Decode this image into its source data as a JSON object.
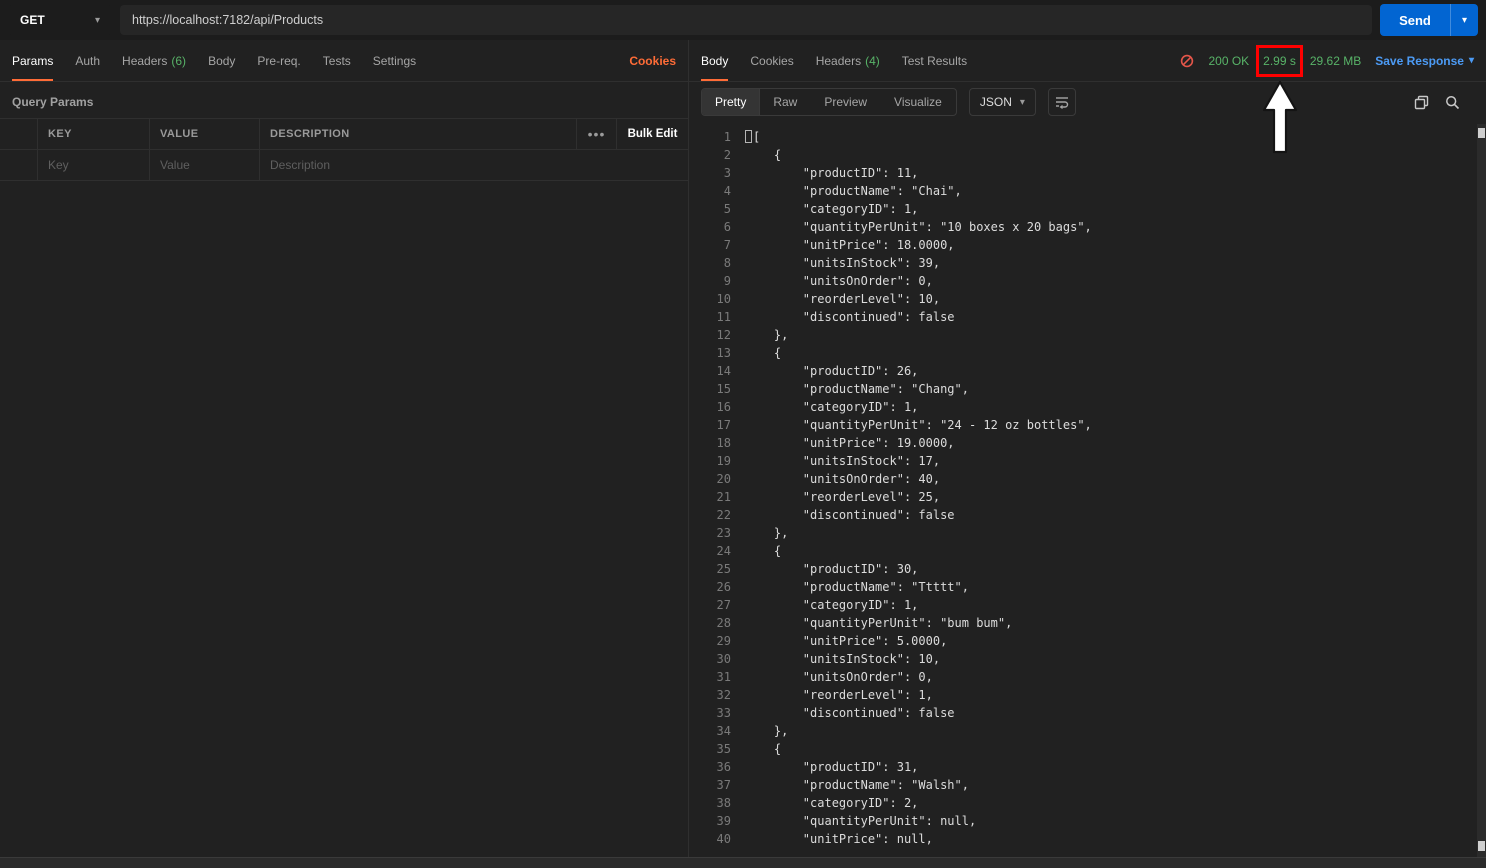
{
  "colors": {
    "accent_orange": "#ff6c37",
    "status_green": "#58b368",
    "link_blue": "#4c9bf5",
    "send_blue": "#0265d2",
    "annotation_red": "#ff0000"
  },
  "icons": {
    "chevron_down": "▾",
    "more": "•••"
  },
  "request_bar": {
    "method": "GET",
    "url": "https://localhost:7182/api/Products",
    "send_label": "Send"
  },
  "request_tabs": {
    "items": [
      {
        "label": "Params",
        "count": "",
        "active": true
      },
      {
        "label": "Auth",
        "count": "",
        "active": false
      },
      {
        "label": "Headers",
        "count": "(6)",
        "active": false
      },
      {
        "label": "Body",
        "count": "",
        "active": false
      },
      {
        "label": "Pre-req.",
        "count": "",
        "active": false
      },
      {
        "label": "Tests",
        "count": "",
        "active": false
      },
      {
        "label": "Settings",
        "count": "",
        "active": false
      }
    ],
    "cookies_link": "Cookies"
  },
  "query_params": {
    "title": "Query Params",
    "columns": [
      "KEY",
      "VALUE",
      "DESCRIPTION"
    ],
    "more_icon": "•••",
    "bulk_edit_label": "Bulk Edit",
    "row_placeholders": {
      "key": "Key",
      "value": "Value",
      "description": "Description"
    }
  },
  "response": {
    "tabs": [
      {
        "label": "Body",
        "count": "",
        "active": true
      },
      {
        "label": "Cookies",
        "count": "",
        "active": false
      },
      {
        "label": "Headers",
        "count": "(4)",
        "active": false
      },
      {
        "label": "Test Results",
        "count": "",
        "active": false
      }
    ],
    "meta": {
      "status": "200 OK",
      "time": "2.99 s",
      "size": "29.62 MB",
      "save_label": "Save Response"
    },
    "toolbar": {
      "views": [
        "Pretty",
        "Raw",
        "Preview",
        "Visualize"
      ],
      "active_view": "Pretty",
      "format": "JSON"
    }
  },
  "annotation": {
    "highlight_target": "response-time",
    "highlighted_value": "2.99 s"
  },
  "response_body": {
    "language": "json",
    "lines": [
      "[",
      "    {",
      "        \"productID\": 11,",
      "        \"productName\": \"Chai\",",
      "        \"categoryID\": 1,",
      "        \"quantityPerUnit\": \"10 boxes x 20 bags\",",
      "        \"unitPrice\": 18.0000,",
      "        \"unitsInStock\": 39,",
      "        \"unitsOnOrder\": 0,",
      "        \"reorderLevel\": 10,",
      "        \"discontinued\": false",
      "    },",
      "    {",
      "        \"productID\": 26,",
      "        \"productName\": \"Chang\",",
      "        \"categoryID\": 1,",
      "        \"quantityPerUnit\": \"24 - 12 oz bottles\",",
      "        \"unitPrice\": 19.0000,",
      "        \"unitsInStock\": 17,",
      "        \"unitsOnOrder\": 40,",
      "        \"reorderLevel\": 25,",
      "        \"discontinued\": false",
      "    },",
      "    {",
      "        \"productID\": 30,",
      "        \"productName\": \"Ttttt\",",
      "        \"categoryID\": 1,",
      "        \"quantityPerUnit\": \"bum bum\",",
      "        \"unitPrice\": 5.0000,",
      "        \"unitsInStock\": 10,",
      "        \"unitsOnOrder\": 0,",
      "        \"reorderLevel\": 1,",
      "        \"discontinued\": false",
      "    },",
      "    {",
      "        \"productID\": 31,",
      "        \"productName\": \"Walsh\",",
      "        \"categoryID\": 2,",
      "        \"quantityPerUnit\": null,",
      "        \"unitPrice\": null,"
    ]
  }
}
